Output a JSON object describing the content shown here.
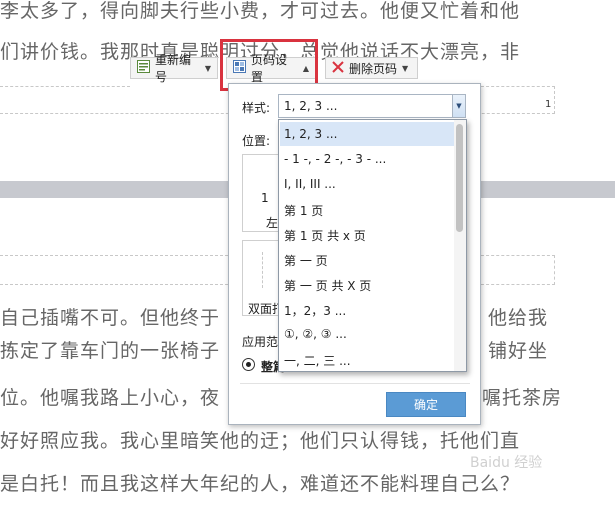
{
  "document": {
    "lines_top": [
      "李太多了，得向脚夫行些小费，才可过去。他便又忙着和他",
      "们讲价钱。我那时真是聪明过分，总觉他说话不大漂亮，非"
    ],
    "lines_bottom": [
      "自己插嘴不可。但他终于",
      "拣定了靠车门的一张椅子",
      "位。他嘱我路上小心，夜",
      "好好照应我。我心里暗笑他的迂；他们只认得钱，托他们直",
      "是白托！而且我这样大年纪的人，难道还不能料理自己么？"
    ],
    "lines_bottom_right": [
      "他给我",
      "铺好坐",
      "嘱托茶房"
    ],
    "page_number_shown": "1"
  },
  "toolbar": {
    "renumber_label": "重新编号",
    "page_setup_label": "页码设置",
    "delete_label": "删除页码"
  },
  "dialog": {
    "style_label": "样式:",
    "style_value": "1, 2, 3 ...",
    "position_label": "位置:",
    "left_label": "左",
    "preview_number": "1",
    "double_label": "双面打",
    "apply_label": "应用范",
    "whole_label": "整篇",
    "ok_label": "确定"
  },
  "dropdown": {
    "items": [
      "1, 2, 3 ...",
      "- 1 -, - 2 -, - 3 - ...",
      "I, II, III ...",
      "第 1 页",
      "第 1 页 共 x 页",
      "第 一 页",
      "第 一 页 共 X 页",
      "1，2，3 ...",
      "①, ②, ③ ...",
      "一, 二, 三 ..."
    ],
    "selected_index": 0
  },
  "watermark": "Baidu 经验",
  "colors": {
    "highlight_border": "#d9333f",
    "ok_button": "#5b9bd5",
    "selected_item": "#d8e6f7"
  }
}
